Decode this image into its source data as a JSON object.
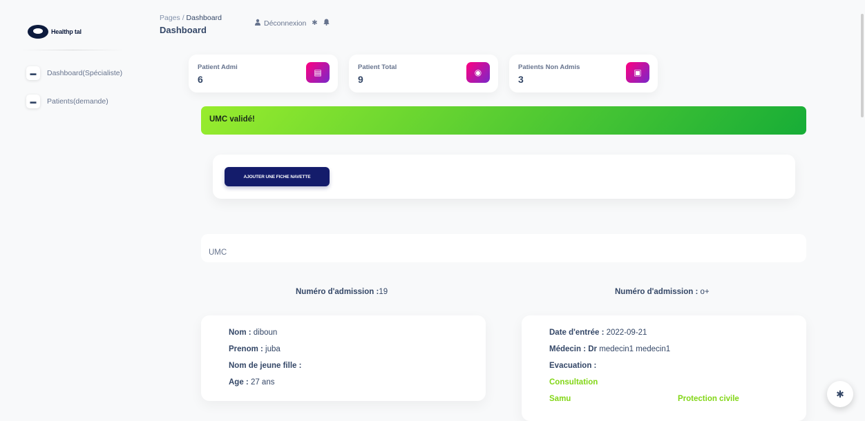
{
  "brand": {
    "name": "Healthp  tal"
  },
  "sidebar": {
    "items": [
      {
        "label": "Dashboard(Spécialiste)",
        "icon": "store-icon"
      },
      {
        "label": "Patients(demande)",
        "icon": "store-icon"
      }
    ]
  },
  "header": {
    "breadcrumb_root": "Pages",
    "breadcrumb_sep": "/",
    "breadcrumb_current": "Dashboard",
    "title": "Dashboard",
    "logout_label": "Déconnexion"
  },
  "stats": [
    {
      "label": "Patient Admi",
      "value": "6",
      "icon": "layers-icon"
    },
    {
      "label": "Patient Total",
      "value": "9",
      "icon": "globe-icon"
    },
    {
      "label": "Patients Non Admis",
      "value": "3",
      "icon": "contact-card-icon"
    }
  ],
  "alert": {
    "text": "UMC validé!"
  },
  "actions": {
    "add_button": "AJOUTER UNE FICHE NAVETTE"
  },
  "umc": {
    "label": "UMC"
  },
  "admission": {
    "left_label": "Numéro d'admission :",
    "left_value": "19",
    "right_label": "Numéro d'admission :",
    "right_value": " o+"
  },
  "patient": {
    "nom_label": "Nom :",
    "nom": " diboun",
    "prenom_label": "Prenom :",
    "prenom": " juba",
    "jeune_fille_label": "Nom de jeune fille :",
    "jeune_fille": "",
    "age_label": "Age :",
    "age": " 27 ans"
  },
  "entry": {
    "date_label": "Date d'entrée :",
    "date": " 2022-09-21",
    "medecin_label": "Médecin : Dr",
    "medecin": " medecin1 medecin1",
    "evacuation_label": "Evacuation :",
    "evacuation": "",
    "consultation": "Consultation",
    "samu": "Samu",
    "protection_civile": "Protection civile"
  },
  "colors": {
    "accent_gradient_start": "#7928ca",
    "accent_gradient_end": "#ff0080",
    "success_gradient_start": "#17ad37",
    "success_gradient_end": "#98ec2d",
    "button_navy": "#141c6b",
    "green_text": "#82d616"
  }
}
